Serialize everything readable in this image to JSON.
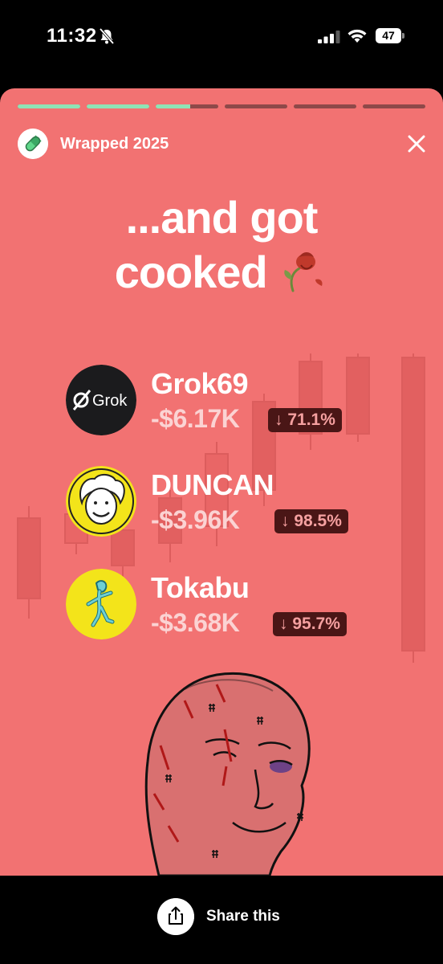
{
  "status_bar": {
    "time": "11:32",
    "battery": "47",
    "icons": [
      "bell-slash-icon",
      "cellular-signal-icon",
      "wifi-icon",
      "battery-icon"
    ]
  },
  "story": {
    "progress": [
      1,
      1,
      0.55,
      0,
      0,
      0
    ],
    "header_title": "Wrapped 2025",
    "logo_icon": "pill-icon",
    "close_icon": "close-icon",
    "headline_line1": "...and got",
    "headline_line2": "cooked",
    "headline_emoji": "wilted-rose-emoji",
    "tokens": [
      {
        "name": "Grok69",
        "loss": "-$6.17K",
        "pct": "↓ 71.1%",
        "avatar": "grok-logo",
        "logo_text": "Grok"
      },
      {
        "name": "DUNCAN",
        "loss": "-$3.96K",
        "pct": "↓ 98.5%",
        "avatar": "duncan-face"
      },
      {
        "name": "Tokabu",
        "loss": "-$3.68K",
        "pct": "↓ 95.7%",
        "avatar": "tokabu-figure"
      }
    ],
    "illustration": "bruised-wojak-face"
  },
  "share": {
    "label": "Share this",
    "icon": "share-icon"
  },
  "colors": {
    "card_bg": "#f27272",
    "progress_done": "#8fe3b5",
    "badge_bg": "#4a1616",
    "badge_text": "#f5a0a0"
  }
}
